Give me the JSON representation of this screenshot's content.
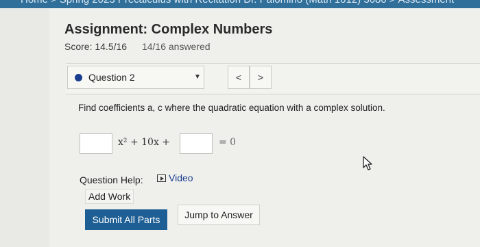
{
  "breadcrumb": {
    "items": [
      "Home",
      "Spring 2023 Precalculus with Recitation Dr. Palomino (Math 1012) 3680",
      "Assessment"
    ],
    "separator": ">"
  },
  "assignment": {
    "title": "Assignment: Complex Numbers",
    "score": "Score: 14.5/16",
    "answered": "14/16 answered"
  },
  "question_nav": {
    "selected": "Question 2",
    "caret": "▼",
    "prev": "<",
    "next": ">"
  },
  "question": {
    "prompt": "Find coefficients a, c where the quadratic equation with a complex solution.",
    "equation_middle": "x² + 10x +",
    "equation_end": "= 0",
    "answer_a": "",
    "answer_c": ""
  },
  "help": {
    "label": "Question Help:",
    "video": "Video",
    "add_work": "Add Work"
  },
  "actions": {
    "submit": "Submit All Parts",
    "jump": "Jump to Answer"
  },
  "colors": {
    "accent": "#1d5f94",
    "dot": "#1a3d8f"
  }
}
